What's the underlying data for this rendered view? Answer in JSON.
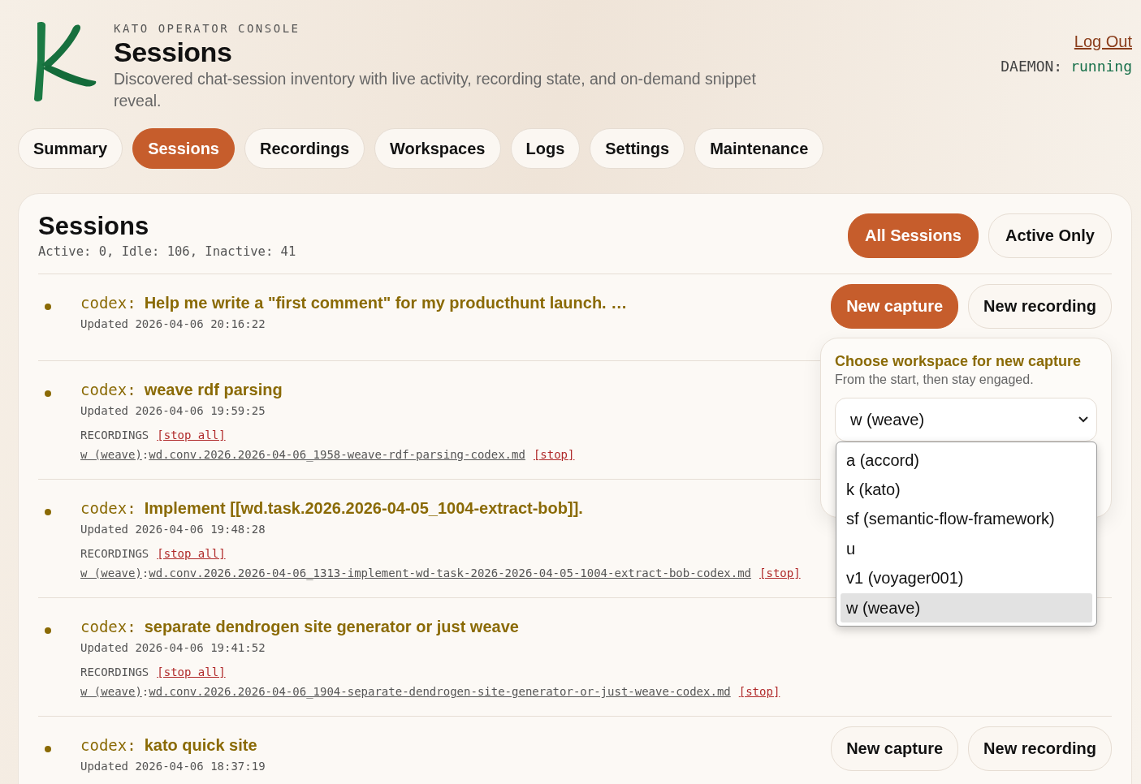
{
  "header": {
    "kicker": "KATO OPERATOR CONSOLE",
    "title": "Sessions",
    "description": "Discovered chat-session inventory with live activity, recording state, and on-demand snippet reveal.",
    "logout": "Log Out",
    "daemon_label": "DAEMON:",
    "daemon_status": "running"
  },
  "tabs": [
    {
      "label": "Summary",
      "selected": false
    },
    {
      "label": "Sessions",
      "selected": true
    },
    {
      "label": "Recordings",
      "selected": false
    },
    {
      "label": "Workspaces",
      "selected": false
    },
    {
      "label": "Logs",
      "selected": false
    },
    {
      "label": "Settings",
      "selected": false
    },
    {
      "label": "Maintenance",
      "selected": false
    }
  ],
  "panel": {
    "title": "Sessions",
    "counts": "Active: 0, Idle: 106, Inactive: 41",
    "filters": [
      {
        "label": "All Sessions",
        "selected": true
      },
      {
        "label": "Active Only",
        "selected": false
      }
    ]
  },
  "sessions": [
    {
      "agent": "codex:",
      "title": "Help me write a \"first comment\" for my producthunt launch. …",
      "updated": "Updated 2026-04-06 20:16:22",
      "actions": [
        {
          "label": "New capture",
          "selected": true
        },
        {
          "label": "New recording",
          "selected": false
        }
      ],
      "workspace_picker": {
        "title": "Choose workspace for new capture",
        "subtitle": "From the start, then stay engaged.",
        "value": "w (weave)",
        "options": [
          {
            "label": "a (accord)",
            "selected": false
          },
          {
            "label": "k (kato)",
            "selected": false
          },
          {
            "label": "sf (semantic-flow-framework)",
            "selected": false
          },
          {
            "label": "u",
            "selected": false
          },
          {
            "label": "v1 (voyager001)",
            "selected": false
          },
          {
            "label": "w (weave)",
            "selected": true
          }
        ]
      }
    },
    {
      "agent": "codex:",
      "title": "weave rdf parsing",
      "updated": "Updated 2026-04-06 19:59:25",
      "recordings": {
        "label": "RECORDINGS",
        "stop_all": "[stop all]",
        "items": [
          {
            "workspace": "w (weave)",
            "separator": ":",
            "file": "wd.conv.2026.2026-04-06_1958-weave-rdf-parsing-codex.md",
            "stop": "[stop]"
          }
        ]
      }
    },
    {
      "agent": "codex:",
      "title": "Implement [[wd.task.2026.2026-04-05_1004-extract-bob]].",
      "updated": "Updated 2026-04-06 19:48:28",
      "recordings": {
        "label": "RECORDINGS",
        "stop_all": "[stop all]",
        "items": [
          {
            "workspace": "w (weave)",
            "separator": ":",
            "file": "wd.conv.2026.2026-04-06_1313-implement-wd-task-2026-2026-04-05-1004-extract-bob-codex.md",
            "stop": "[stop]"
          }
        ]
      }
    },
    {
      "agent": "codex:",
      "title": "separate dendrogen site generator or just weave",
      "updated": "Updated 2026-04-06 19:41:52",
      "recordings": {
        "label": "RECORDINGS",
        "stop_all": "[stop all]",
        "items": [
          {
            "workspace": "w (weave)",
            "separator": ":",
            "file": "wd.conv.2026.2026-04-06_1904-separate-dendrogen-site-generator-or-just-weave-codex.md",
            "stop": "[stop]"
          }
        ]
      }
    },
    {
      "agent": "codex:",
      "title": "kato quick site",
      "updated": "Updated 2026-04-06 18:37:19",
      "actions": [
        {
          "label": "New capture",
          "selected": false
        },
        {
          "label": "New recording",
          "selected": false
        }
      ]
    }
  ]
}
